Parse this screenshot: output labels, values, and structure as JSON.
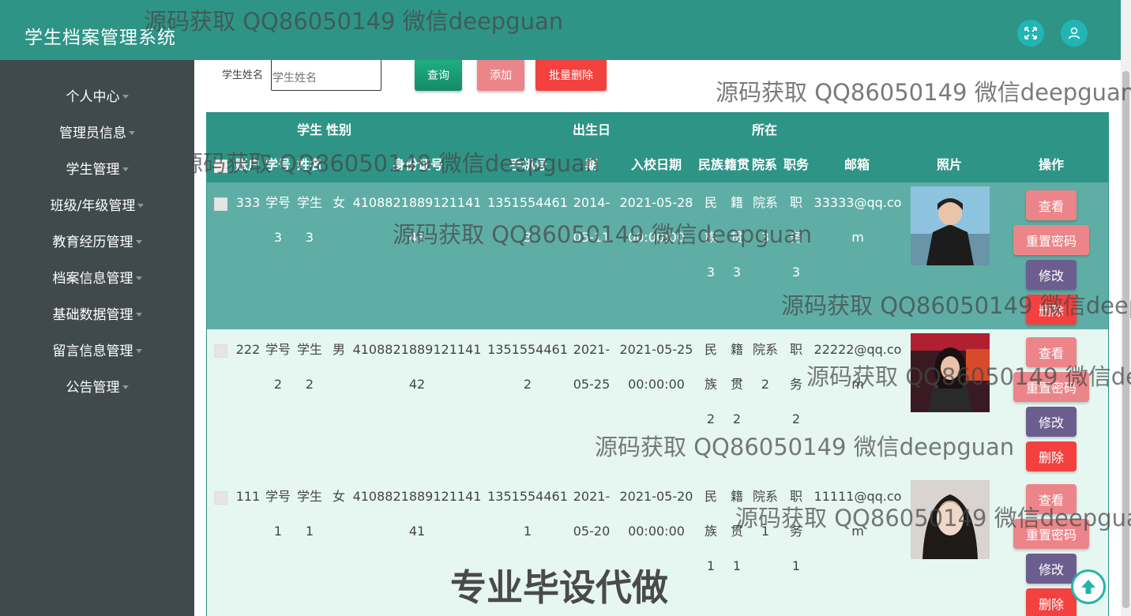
{
  "header": {
    "title": "学生档案管理系统",
    "fullscreen_icon": "expand-arrows-icon",
    "user_icon": "user-icon"
  },
  "sidebar": {
    "items": [
      {
        "label": "个人中心"
      },
      {
        "label": "管理员信息"
      },
      {
        "label": "学生管理"
      },
      {
        "label": "班级/年级管理"
      },
      {
        "label": "教育经历管理"
      },
      {
        "label": "档案信息管理"
      },
      {
        "label": "基础数据管理"
      },
      {
        "label": "留言信息管理"
      },
      {
        "label": "公告管理"
      }
    ]
  },
  "search": {
    "label": "学生姓名",
    "placeholder": "学生姓名",
    "query_label": "查询",
    "add_label": "添加",
    "batch_delete_label": "批量删除"
  },
  "table": {
    "headers": {
      "account": "账户",
      "student_no": "学号",
      "student_name": "学生姓名",
      "gender": "性别",
      "id_card": "身份证号",
      "phone": "手机号",
      "birthday": "出生日期",
      "enroll_date": "入校日期",
      "ethnicity": "民族",
      "native_place": "籍贯",
      "department": "所在院系",
      "position": "职务",
      "email": "邮箱",
      "photo": "照片",
      "actions": "操作"
    },
    "rows": [
      {
        "account": "333",
        "student_no": "学号3",
        "name": "学生3",
        "gender": "女",
        "id_card": "410882188912114143",
        "phone": "13515544613",
        "birthday": "2014-05-11",
        "enroll_date": "2021-05-28 00:00:00",
        "ethnicity": "民族3",
        "native_place": "籍贯3",
        "department": "院系3",
        "position": "职务3",
        "email": "33333@qq.com"
      },
      {
        "account": "222",
        "student_no": "学号2",
        "name": "学生2",
        "gender": "男",
        "id_card": "410882188912114142",
        "phone": "13515544612",
        "birthday": "2021-05-25",
        "enroll_date": "2021-05-25 00:00:00",
        "ethnicity": "民族2",
        "native_place": "籍贯2",
        "department": "院系2",
        "position": "职务2",
        "email": "22222@qq.com"
      },
      {
        "account": "111",
        "student_no": "学号1",
        "name": "学生1",
        "gender": "女",
        "id_card": "410882188912114141",
        "phone": "13515544611",
        "birthday": "2021-05-20",
        "enroll_date": "2021-05-20 00:00:00",
        "ethnicity": "民族1",
        "native_place": "籍贯1",
        "department": "院系1",
        "position": "职务1",
        "email": "11111@qq.com"
      }
    ],
    "action_labels": {
      "view": "查看",
      "reset_password": "重置密码",
      "edit": "修改",
      "delete": "删除"
    }
  },
  "watermark": {
    "text": "源码获取 QQ86050149 微信deepguan",
    "big_text": "专业毕设代做"
  },
  "colors": {
    "header": "#2e9486",
    "sidebar": "#404a4c",
    "view_button": "#e7787c",
    "reset_button": "#e7787c",
    "edit_button": "#6b5e8e",
    "delete_button": "#f2413f",
    "query_button": "#1aa37b"
  }
}
